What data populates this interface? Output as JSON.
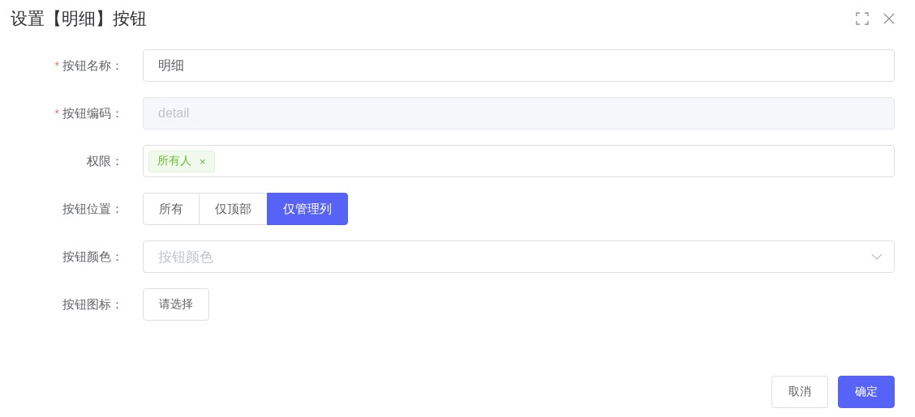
{
  "dialog": {
    "title": "设置【明细】按钮"
  },
  "fields": [
    {
      "kind": "input",
      "label": "按钮名称：",
      "required_mark": "*",
      "value": "明细",
      "disabled": false
    },
    {
      "kind": "input",
      "label": "按钮编码：",
      "required_mark": "*",
      "value": "detail",
      "disabled": true
    },
    {
      "kind": "tags",
      "label": "权限：",
      "tags": [
        {
          "text": "所有人",
          "close": "×"
        }
      ]
    },
    {
      "kind": "radio",
      "label": "按钮位置：",
      "options": [
        {
          "label": "所有",
          "selected": false
        },
        {
          "label": "仅顶部",
          "selected": false
        },
        {
          "label": "仅管理列",
          "selected": true
        }
      ]
    },
    {
      "kind": "select",
      "label": "按钮颜色：",
      "placeholder": "按钮颜色"
    },
    {
      "kind": "button",
      "label": "按钮图标：",
      "button": "请选择"
    }
  ],
  "footer": {
    "buttons": [
      {
        "label": "取消",
        "kind": "default"
      },
      {
        "label": "确定",
        "kind": "primary"
      }
    ]
  }
}
